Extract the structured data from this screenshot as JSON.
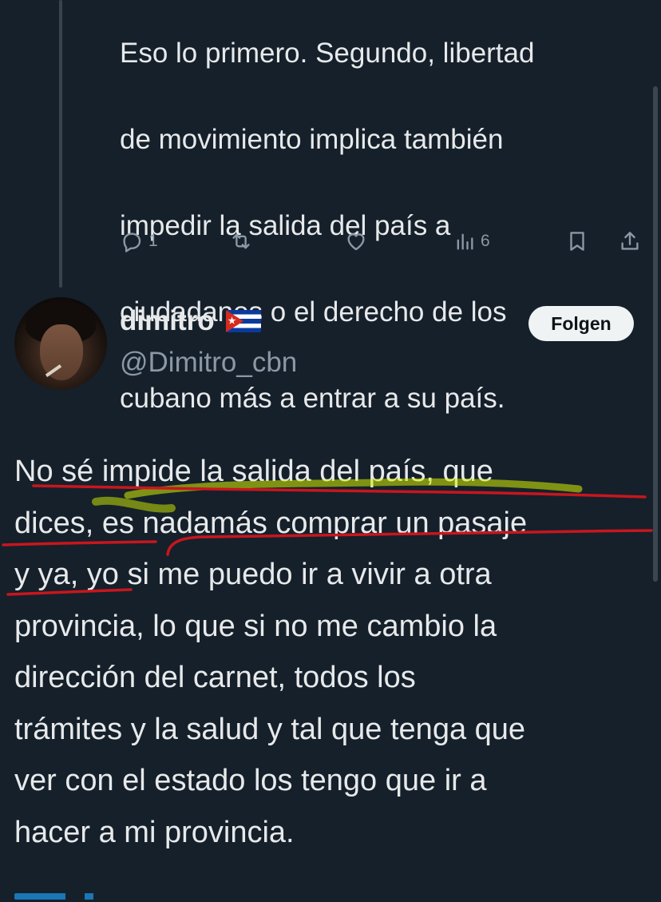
{
  "previous_tweet": {
    "lines": [
      "Eso lo primero. Segundo, libertad",
      "de movimiento implica también",
      "impedir la salida del país a",
      "ciudadanos o el derecho de los",
      "cubano más a entrar a su país."
    ],
    "actions": {
      "reply_icon": "reply-icon",
      "reply_count": "1",
      "retweet_icon": "retweet-icon",
      "like_icon": "heart-icon",
      "views_icon": "views-icon",
      "views_count": "6",
      "bookmark_icon": "bookmark-icon",
      "share_icon": "share-icon"
    }
  },
  "tweet": {
    "author": {
      "name": "dimitro",
      "flag": "cuba-flag",
      "handle": "@Dimitro_cbn"
    },
    "follow_label": "Folgen",
    "lines": [
      "No sé impide la salida del país, que",
      "dices, es nadamás comprar un pasaje",
      "y ya, yo si me puedo ir a vivir a otra",
      "provincia, lo que si no me cambio la",
      "dirección del carnet, todos los",
      "trámites y la salud y tal que tenga que",
      "ver con el estado los tengo que ir a",
      "hacer a mi provincia."
    ]
  },
  "colors": {
    "background": "#15202b",
    "text": "#e7e9ea",
    "muted": "#8b98a5",
    "annotation_red": "#c8161d",
    "annotation_yellow": "#d7f000"
  }
}
